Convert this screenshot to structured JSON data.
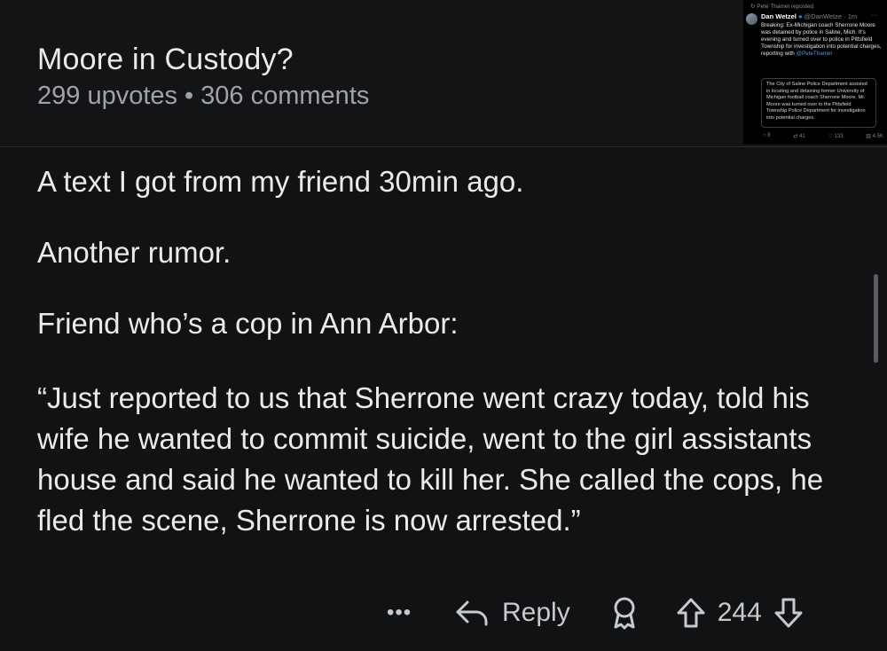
{
  "post": {
    "title": "Moore in Custody?",
    "upvotes": "299 upvotes",
    "separator": "•",
    "comments": "306 comments"
  },
  "tweet": {
    "repost_line": "Pete Thamel reposted",
    "author": "Dan Wetzel",
    "handle": "@DanWetze · 1m",
    "body": "Breaking: Ex-Michigan coach Sherrone Moore was detained by police in Saline, Mich. It's evening and turned over to police in Pittsfield Township for investigation into potential charges, reporting with",
    "mention": "@PeteThamel",
    "quote": "The City of Saline Police Department assisted in locating and detaining former University of Michigan football coach Sherrone Moore. Mr. Moore was turned over to the Pittsfield Township Police Department for investigation into potential charges.",
    "actions": [
      "8",
      "41",
      "133",
      "4.5K"
    ]
  },
  "comment": {
    "line1": "A text I got from my friend 30min ago.",
    "line2": "Another rumor.",
    "line3": "Friend who’s a cop in Ann Arbor:",
    "quote": "“Just reported to us that Sherrone went crazy today, told his wife he wanted to commit suicide, went to the girl assistants house and said he wanted to kill her. She called the cops, he fled the scene, Sherrone is now arrested.”"
  },
  "actions": {
    "more": "•••",
    "reply_label": "Reply",
    "vote_count": "244",
    "icons": [
      "more-icon",
      "reply-arrow-icon",
      "award-icon",
      "upvote-icon",
      "downvote-icon"
    ]
  },
  "colors": {
    "background": "#111214",
    "text": "#e9eaeb",
    "muted": "#9fa3a8",
    "link": "#4a9ae8"
  }
}
